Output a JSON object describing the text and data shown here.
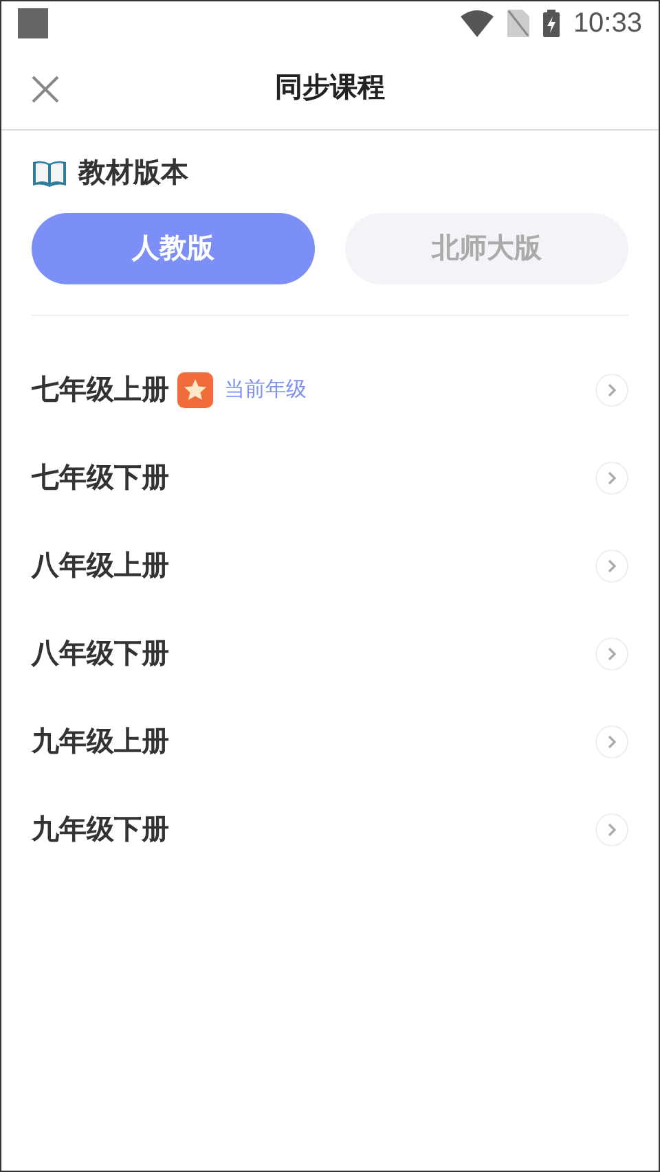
{
  "status_bar": {
    "time": "10:33"
  },
  "header": {
    "title": "同步课程"
  },
  "edition_section": {
    "title": "教材版本",
    "editions": [
      {
        "label": "人教版",
        "selected": true
      },
      {
        "label": "北师大版",
        "selected": false
      }
    ]
  },
  "current_badge": "当前年级",
  "grades": [
    {
      "label": "七年级上册",
      "current": true
    },
    {
      "label": "七年级下册",
      "current": false
    },
    {
      "label": "八年级上册",
      "current": false
    },
    {
      "label": "八年级下册",
      "current": false
    },
    {
      "label": "九年级上册",
      "current": false
    },
    {
      "label": "九年级下册",
      "current": false
    }
  ]
}
